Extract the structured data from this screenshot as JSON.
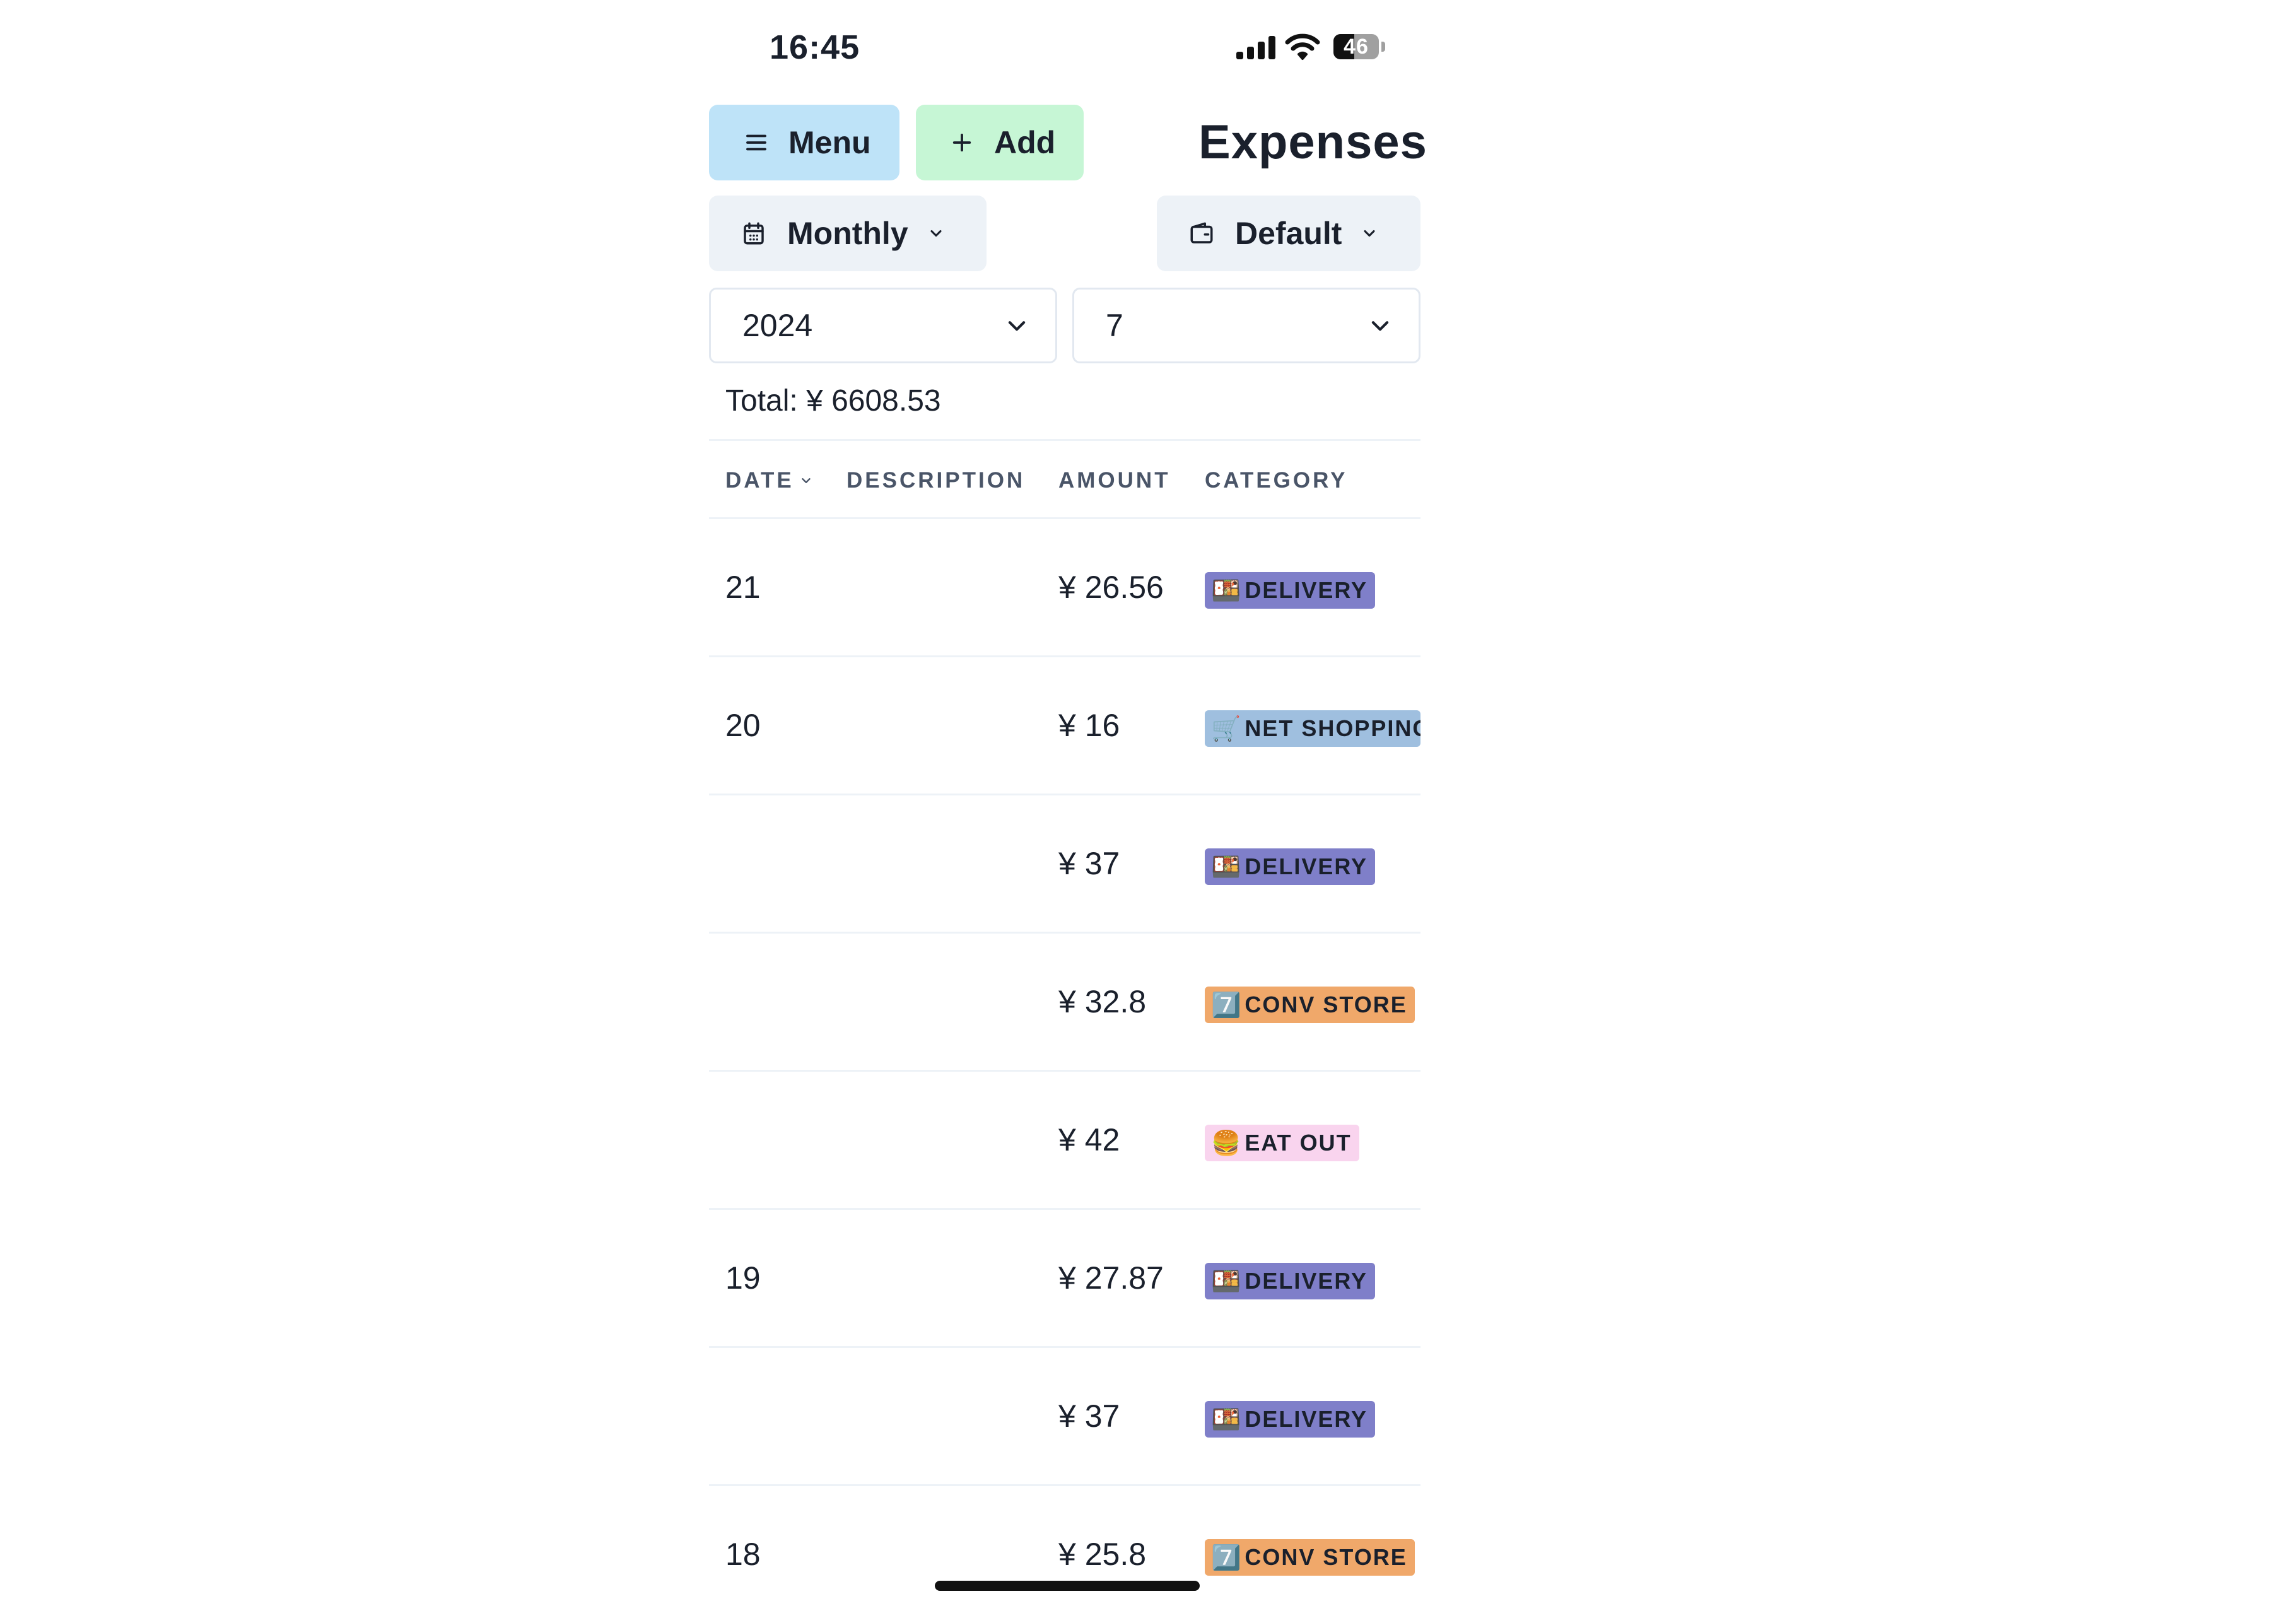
{
  "status_bar": {
    "time": "16:45",
    "battery_level": "46",
    "battery_fraction": 0.46
  },
  "header": {
    "menu_label": "Menu",
    "add_label": "Add",
    "title": "Expenses"
  },
  "filters": {
    "period_label": "Monthly",
    "wallet_label": "Default",
    "year_value": "2024",
    "month_value": "7"
  },
  "summary": {
    "total_text": "Total: ¥ 6608.53"
  },
  "table": {
    "headers": {
      "date": "DATE",
      "description": "DESCRIPTION",
      "amount": "AMOUNT",
      "category": "CATEGORY"
    },
    "rows": [
      {
        "date": "21",
        "description": "",
        "amount": "¥ 26.56",
        "category": "DELIVERY",
        "emoji": "🍱",
        "color": "#7f7fc9"
      },
      {
        "date": "20",
        "description": "",
        "amount": "¥ 16",
        "category": "NET SHOPPING",
        "emoji": "🛒",
        "color": "#9fbfdf"
      },
      {
        "date": "",
        "description": "",
        "amount": "¥ 37",
        "category": "DELIVERY",
        "emoji": "🍱",
        "color": "#7f7fc9"
      },
      {
        "date": "",
        "description": "",
        "amount": "¥ 32.8",
        "category": "CONV STORE",
        "emoji": "7️⃣",
        "color": "#f0a86a"
      },
      {
        "date": "",
        "description": "",
        "amount": "¥ 42",
        "category": "EAT OUT",
        "emoji": "🍔",
        "color": "#f9d4ee"
      },
      {
        "date": "19",
        "description": "",
        "amount": "¥ 27.87",
        "category": "DELIVERY",
        "emoji": "🍱",
        "color": "#7f7fc9"
      },
      {
        "date": "",
        "description": "",
        "amount": "¥ 37",
        "category": "DELIVERY",
        "emoji": "🍱",
        "color": "#7f7fc9"
      },
      {
        "date": "18",
        "description": "",
        "amount": "¥ 25.8",
        "category": "CONV STORE",
        "emoji": "7️⃣",
        "color": "#f0a86a"
      }
    ]
  }
}
